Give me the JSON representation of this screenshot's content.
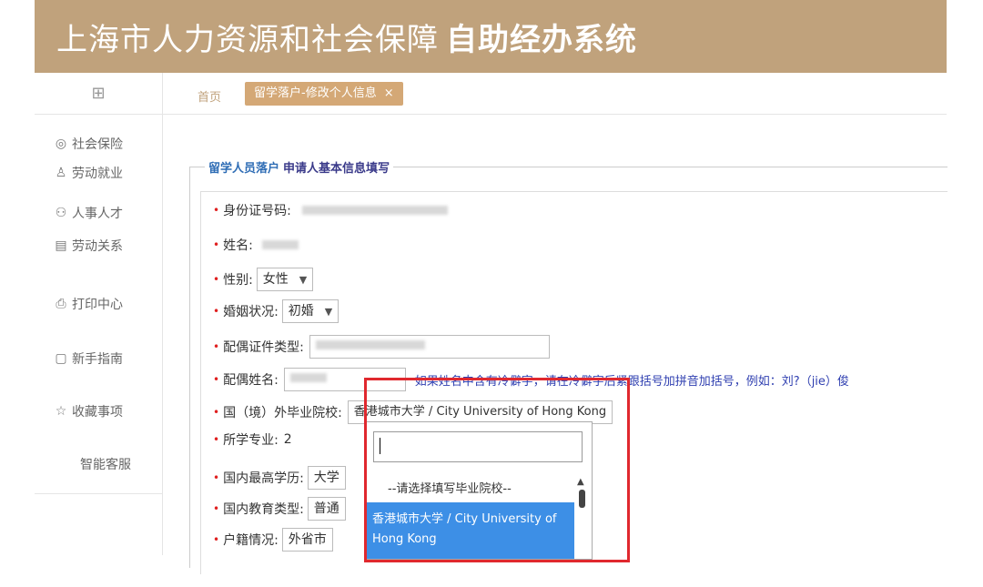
{
  "header": {
    "title_part1": "上海市人力资源和社会保障",
    "title_part2": "自助经办系统"
  },
  "sidebar": {
    "top_icon": "grid-icon",
    "items": [
      {
        "label": "社会保险",
        "icon": "shield-icon"
      },
      {
        "label": "劳动就业",
        "icon": "person-badge-icon"
      },
      {
        "label": "人事人才",
        "icon": "people-icon"
      },
      {
        "label": "劳动关系",
        "icon": "document-icon"
      },
      {
        "label": "打印中心",
        "icon": "printer-icon"
      },
      {
        "label": "新手指南",
        "icon": "guide-icon"
      },
      {
        "label": "收藏事项",
        "icon": "star-icon"
      },
      {
        "label": "智能客服",
        "icon": ""
      }
    ]
  },
  "tabs": {
    "home": "首页",
    "active": "留学落户-修改个人信息",
    "close": "×"
  },
  "legend": {
    "part1": "留学人员落户",
    "part2": "申请人基本信息填写"
  },
  "form": {
    "id_label": "身份证号码:",
    "name_label": "姓名:",
    "gender_label": "性别:",
    "gender_value": "女性",
    "marital_label": "婚姻状况:",
    "marital_value": "初婚",
    "spouse_id_type_label": "配偶证件类型:",
    "spouse_name_label": "配偶姓名:",
    "spouse_note": "如果姓名中含有冷僻字，请在冷僻字后紧跟括号加拼音加括号，例如：刘?（jie）俊",
    "school_label": "国（境）外毕业院校:",
    "school_value": "香港城市大学 / City University of Hong Kong",
    "major_label": "所学专业:",
    "major_value": "2",
    "edu_label": "国内最高学历:",
    "edu_value": "大学",
    "edu_type_label": "国内教育类型:",
    "edu_type_value": "普通",
    "hukou_label": "户籍情况:",
    "hukou_value": "外省市"
  },
  "dropdown": {
    "search_value": "",
    "placeholder_option": "--请选择填写毕业院校--",
    "selected_option": "香港城市大学 / City University of Hong Kong"
  }
}
